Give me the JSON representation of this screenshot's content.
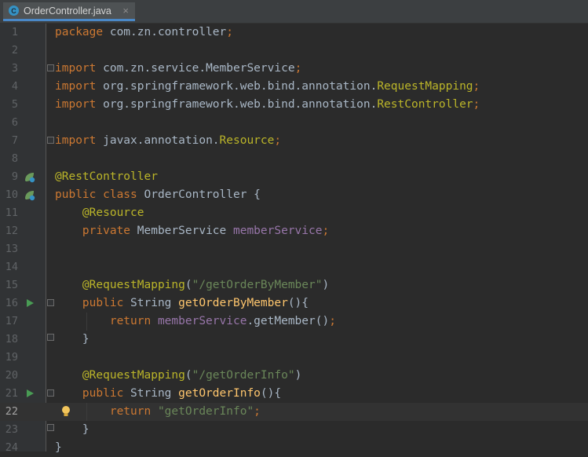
{
  "tab": {
    "filename": "OrderController.java",
    "icon_letter": "C",
    "close": "×"
  },
  "lines": [
    {
      "n": "1",
      "parts": [
        {
          "t": "package",
          "c": "kw"
        },
        {
          "t": " com.zn.controller",
          "c": "ident"
        },
        {
          "t": ";",
          "c": "kw"
        }
      ]
    },
    {
      "n": "2",
      "parts": []
    },
    {
      "n": "3",
      "parts": [
        {
          "t": "import",
          "c": "kw"
        },
        {
          "t": " com.zn.service.MemberService",
          "c": "ident"
        },
        {
          "t": ";",
          "c": "kw"
        }
      ]
    },
    {
      "n": "4",
      "parts": [
        {
          "t": "import",
          "c": "kw"
        },
        {
          "t": " org.springframework.web.bind.annotation.",
          "c": "ident"
        },
        {
          "t": "RequestMapping",
          "c": "ann"
        },
        {
          "t": ";",
          "c": "kw"
        }
      ]
    },
    {
      "n": "5",
      "parts": [
        {
          "t": "import",
          "c": "kw"
        },
        {
          "t": " org.springframework.web.bind.annotation.",
          "c": "ident"
        },
        {
          "t": "RestController",
          "c": "ann"
        },
        {
          "t": ";",
          "c": "kw"
        }
      ]
    },
    {
      "n": "6",
      "parts": []
    },
    {
      "n": "7",
      "parts": [
        {
          "t": "import",
          "c": "kw"
        },
        {
          "t": " javax.annotation.",
          "c": "ident"
        },
        {
          "t": "Resource",
          "c": "ann"
        },
        {
          "t": ";",
          "c": "kw"
        }
      ]
    },
    {
      "n": "8",
      "parts": []
    },
    {
      "n": "9",
      "parts": [
        {
          "t": "@RestController",
          "c": "ann"
        }
      ]
    },
    {
      "n": "10",
      "parts": [
        {
          "t": "public class ",
          "c": "kw"
        },
        {
          "t": "OrderController {",
          "c": "ident"
        }
      ]
    },
    {
      "n": "11",
      "parts": [
        {
          "t": "    ",
          "c": "ident"
        },
        {
          "t": "@Resource",
          "c": "ann"
        }
      ]
    },
    {
      "n": "12",
      "parts": [
        {
          "t": "    ",
          "c": "ident"
        },
        {
          "t": "private ",
          "c": "kw"
        },
        {
          "t": "MemberService ",
          "c": "ident"
        },
        {
          "t": "memberService",
          "c": "fld"
        },
        {
          "t": ";",
          "c": "kw"
        }
      ]
    },
    {
      "n": "13",
      "parts": []
    },
    {
      "n": "14",
      "parts": []
    },
    {
      "n": "15",
      "parts": [
        {
          "t": "    ",
          "c": "ident"
        },
        {
          "t": "@RequestMapping",
          "c": "ann"
        },
        {
          "t": "(",
          "c": "ident"
        },
        {
          "t": "\"/getOrderByMember\"",
          "c": "str"
        },
        {
          "t": ")",
          "c": "ident"
        }
      ]
    },
    {
      "n": "16",
      "parts": [
        {
          "t": "    ",
          "c": "ident"
        },
        {
          "t": "public ",
          "c": "kw"
        },
        {
          "t": "String ",
          "c": "ident"
        },
        {
          "t": "getOrderByMember",
          "c": "mth"
        },
        {
          "t": "(){",
          "c": "ident"
        }
      ]
    },
    {
      "n": "17",
      "parts": [
        {
          "t": "        ",
          "c": "ident"
        },
        {
          "t": "return ",
          "c": "kw"
        },
        {
          "t": "memberService",
          "c": "fld"
        },
        {
          "t": ".getMember()",
          "c": "ident"
        },
        {
          "t": ";",
          "c": "kw"
        }
      ]
    },
    {
      "n": "18",
      "parts": [
        {
          "t": "    }",
          "c": "ident"
        }
      ]
    },
    {
      "n": "19",
      "parts": []
    },
    {
      "n": "20",
      "parts": [
        {
          "t": "    ",
          "c": "ident"
        },
        {
          "t": "@RequestMapping",
          "c": "ann"
        },
        {
          "t": "(",
          "c": "ident"
        },
        {
          "t": "\"/getOrderInfo\"",
          "c": "str"
        },
        {
          "t": ")",
          "c": "ident"
        }
      ]
    },
    {
      "n": "21",
      "parts": [
        {
          "t": "    ",
          "c": "ident"
        },
        {
          "t": "public ",
          "c": "kw"
        },
        {
          "t": "String ",
          "c": "ident"
        },
        {
          "t": "getOrderInfo",
          "c": "mth"
        },
        {
          "t": "(){",
          "c": "ident"
        }
      ]
    },
    {
      "n": "22",
      "parts": [
        {
          "t": "        ",
          "c": "ident"
        },
        {
          "t": "return ",
          "c": "kw"
        },
        {
          "t": "\"getOrderInfo\"",
          "c": "str"
        },
        {
          "t": ";",
          "c": "kw"
        }
      ]
    },
    {
      "n": "23",
      "parts": [
        {
          "t": "    }",
          "c": "ident"
        }
      ]
    },
    {
      "n": "24",
      "parts": [
        {
          "t": "}",
          "c": "ident"
        }
      ]
    }
  ],
  "current_line": "22",
  "colors": {
    "background": "#2b2b2b",
    "gutter": "#313335",
    "keyword": "#cc7832",
    "annotation": "#bbb529",
    "field": "#9876aa",
    "string": "#6a8759",
    "method": "#ffc66d",
    "text": "#a9b7c6",
    "line_number": "#606366",
    "tab_underline": "#4a88c7"
  },
  "gutter_icons": [
    {
      "line": "9",
      "icon": "spring-bean-icon"
    },
    {
      "line": "10",
      "icon": "spring-bean-icon"
    },
    {
      "line": "16",
      "icon": "run-icon"
    },
    {
      "line": "21",
      "icon": "run-icon"
    },
    {
      "line": "22",
      "icon": "lightbulb-icon"
    }
  ],
  "fold_markers": [
    "3",
    "7",
    "16",
    "18",
    "21",
    "23"
  ]
}
